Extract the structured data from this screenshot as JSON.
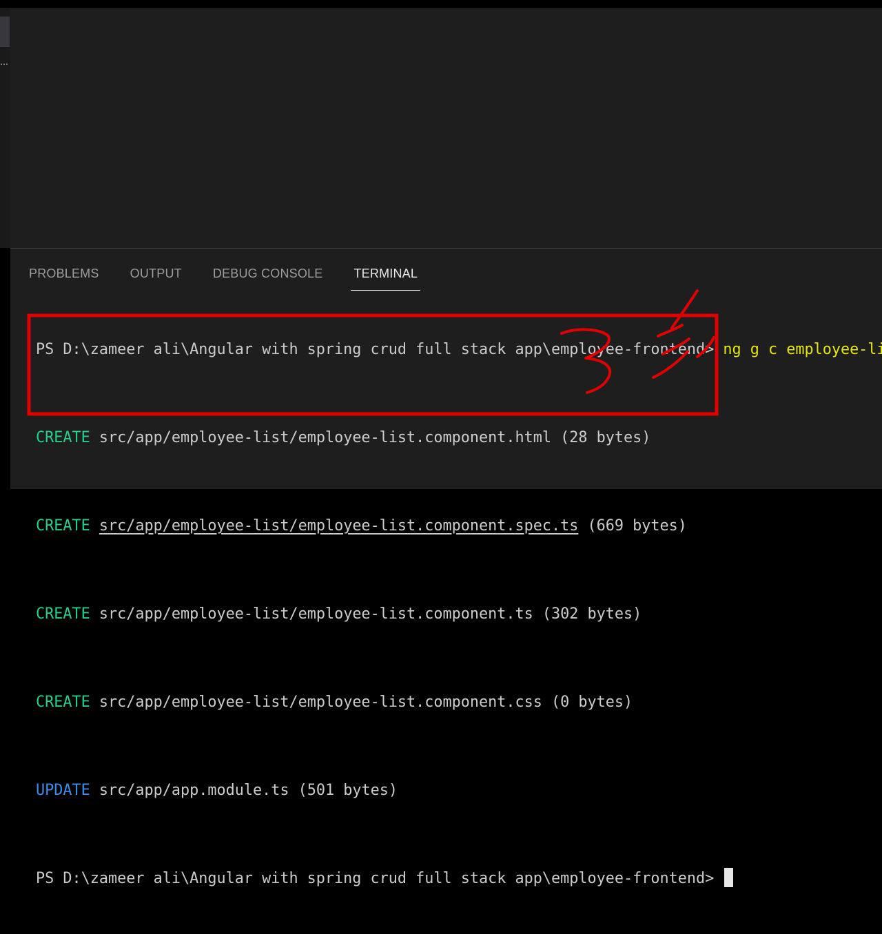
{
  "panel": {
    "tabs": [
      {
        "label": "PROBLEMS",
        "active": false
      },
      {
        "label": "OUTPUT",
        "active": false
      },
      {
        "label": "DEBUG CONSOLE",
        "active": false
      },
      {
        "label": "TERMINAL",
        "active": true
      }
    ]
  },
  "terminal": {
    "prompt": "PS D:\\zameer ali\\Angular with spring crud full stack app\\employee-frontend>",
    "command": "ng g c employee-list",
    "lines": [
      {
        "keyword": "CREATE",
        "path": "src/app/employee-list/employee-list.component.html",
        "info": "(28 bytes)"
      },
      {
        "keyword": "CREATE",
        "path": "src/app/employee-list/employee-list.component.spec.ts",
        "info": "(669 bytes)"
      },
      {
        "keyword": "CREATE",
        "path": "src/app/employee-list/employee-list.component.ts",
        "info": "(302 bytes)"
      },
      {
        "keyword": "CREATE",
        "path": "src/app/employee-list/employee-list.component.css",
        "info": "(0 bytes)"
      },
      {
        "keyword": "UPDATE",
        "path": "src/app/app.module.ts",
        "info": "(501 bytes)"
      }
    ],
    "final_prompt": "PS D:\\zameer ali\\Angular with spring crud full stack app\\employee-frontend>"
  },
  "colors": {
    "background": "#1e1e1e",
    "create_keyword": "#23d18b",
    "update_keyword": "#3b8eea",
    "command": "#e5e510",
    "annotation": "#e00000"
  },
  "annotation": {
    "icon": "hand-drawn-number-3-and-checkmarks"
  }
}
